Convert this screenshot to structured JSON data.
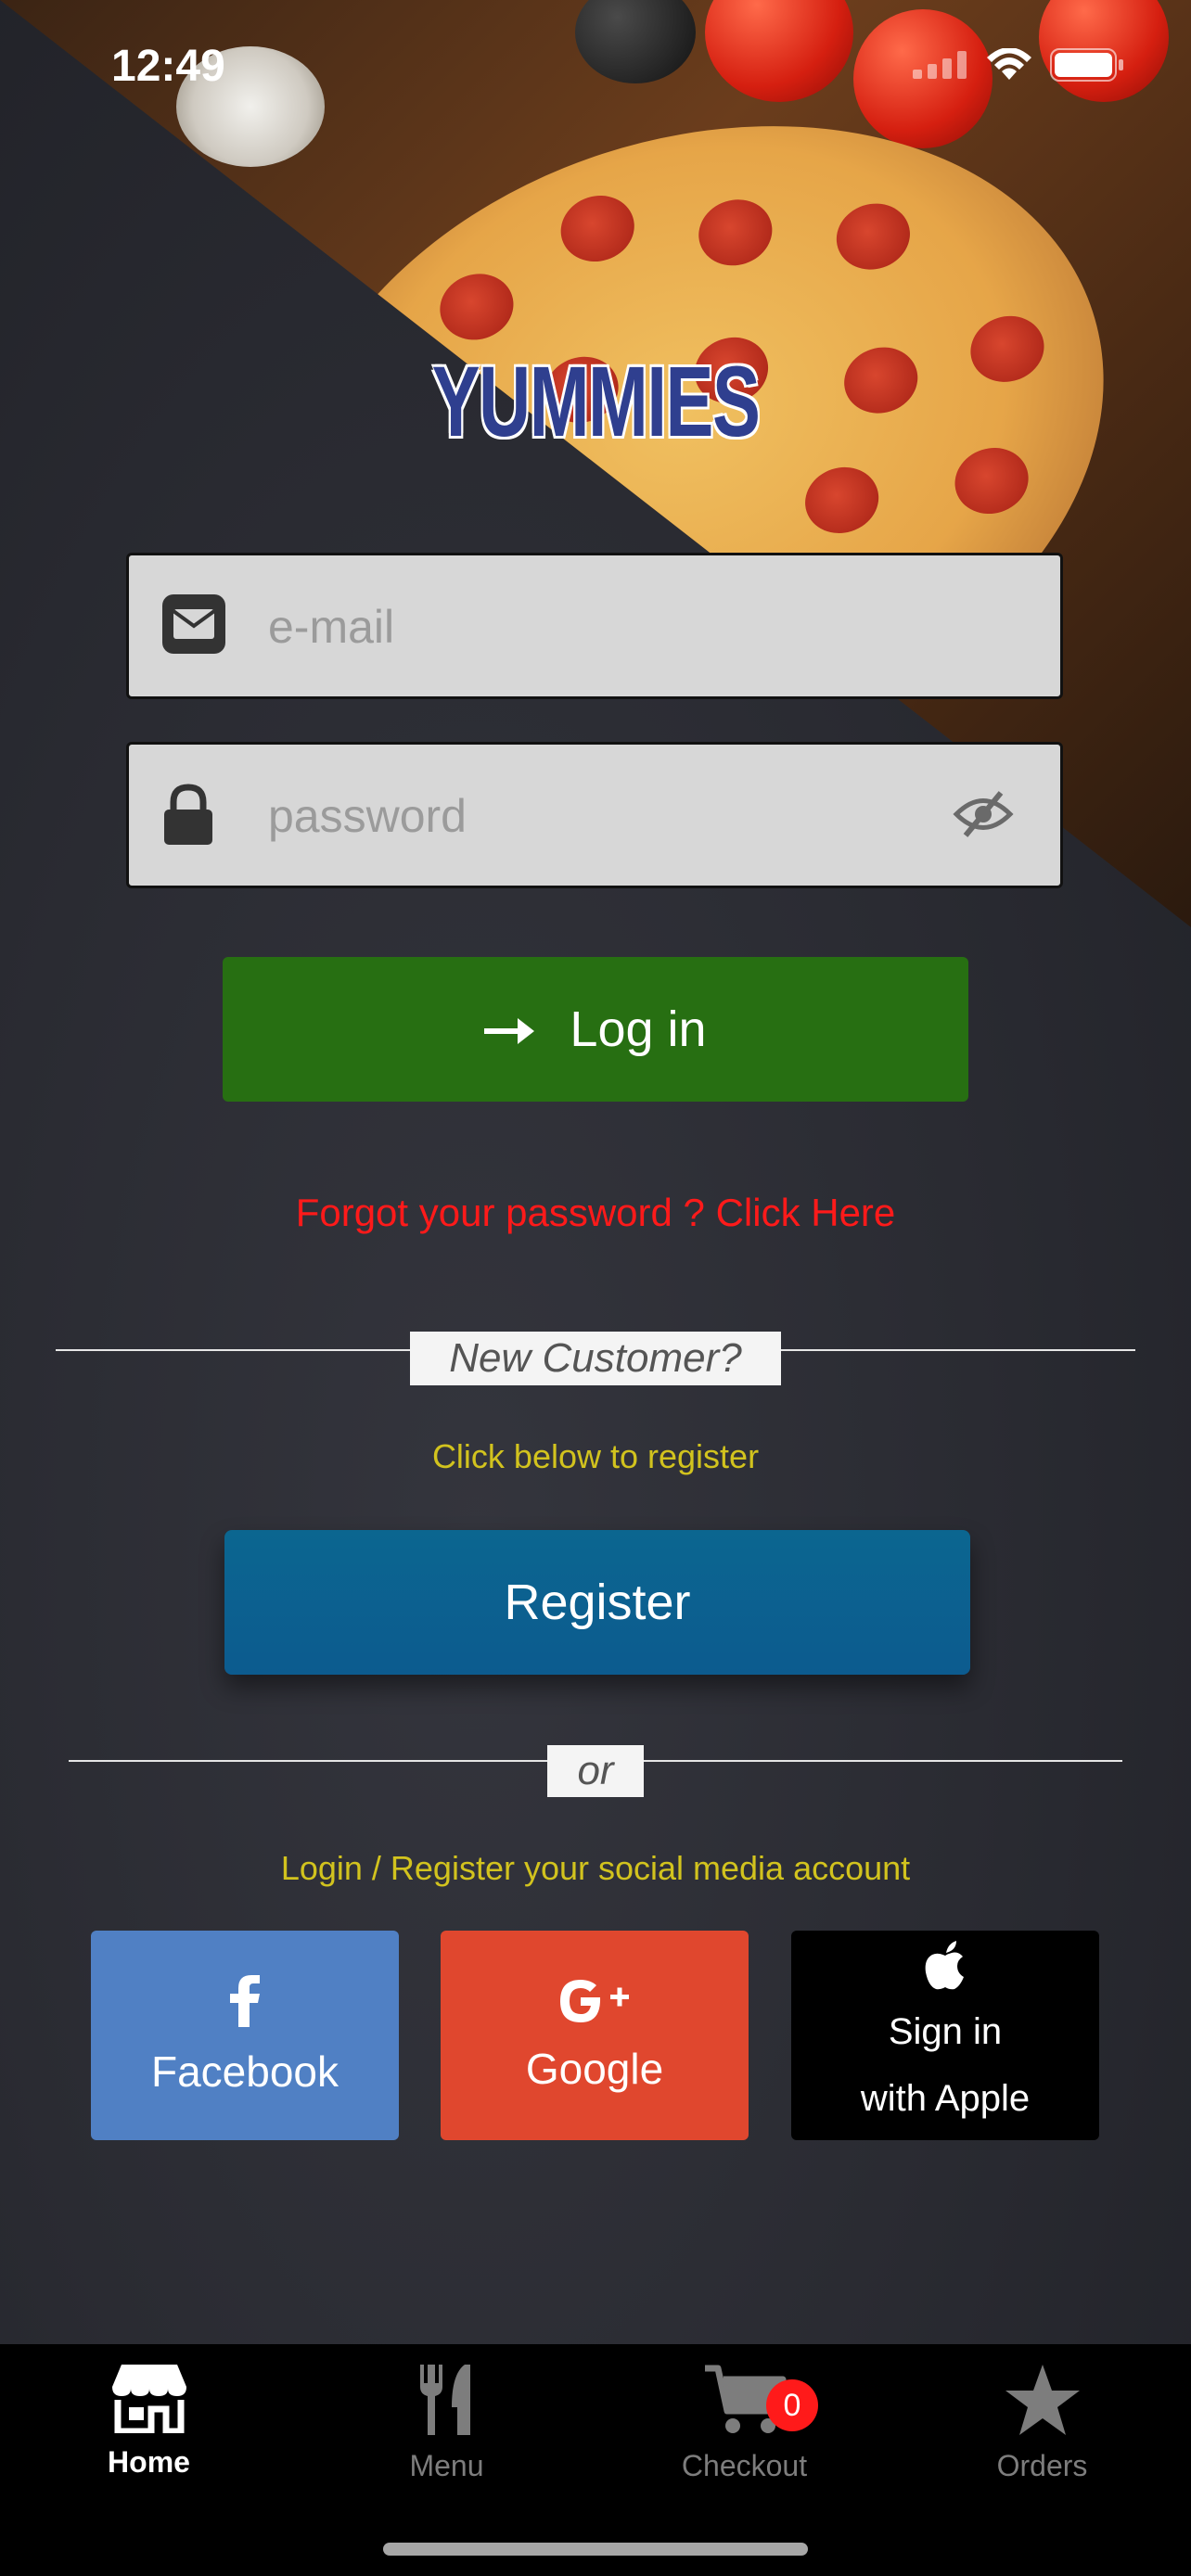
{
  "status": {
    "time": "12:49"
  },
  "logo": {
    "text": "YUMMIES"
  },
  "login": {
    "email_placeholder": "e-mail",
    "password_placeholder": "password",
    "login_label": "Log in",
    "forgot_text": "Forgot your password ? Click Here"
  },
  "register": {
    "heading": "New Customer?",
    "subtext": "Click below to register",
    "button_label": "Register"
  },
  "social": {
    "divider_text": "or",
    "subtext": "Login / Register your social media account",
    "facebook_label": "Facebook",
    "google_label": "Google",
    "apple_line1": "Sign in",
    "apple_line2": "with Apple"
  },
  "tabbar": {
    "items": [
      {
        "label": "Home",
        "icon": "store-icon",
        "active": true
      },
      {
        "label": "Menu",
        "icon": "fork-knife-icon",
        "active": false
      },
      {
        "label": "Checkout",
        "icon": "cart-icon",
        "active": false,
        "badge": "0"
      },
      {
        "label": "Orders",
        "icon": "star-icon",
        "active": false
      }
    ]
  },
  "colors": {
    "login_green": "#276f12",
    "register_blue": "#0c5b8f",
    "forgot_red": "#ff1a1a",
    "subtext_yellow": "#d2c31e",
    "facebook_blue": "#5080c4",
    "google_red": "#e0472e",
    "logo_blue": "#2f3f8f"
  }
}
